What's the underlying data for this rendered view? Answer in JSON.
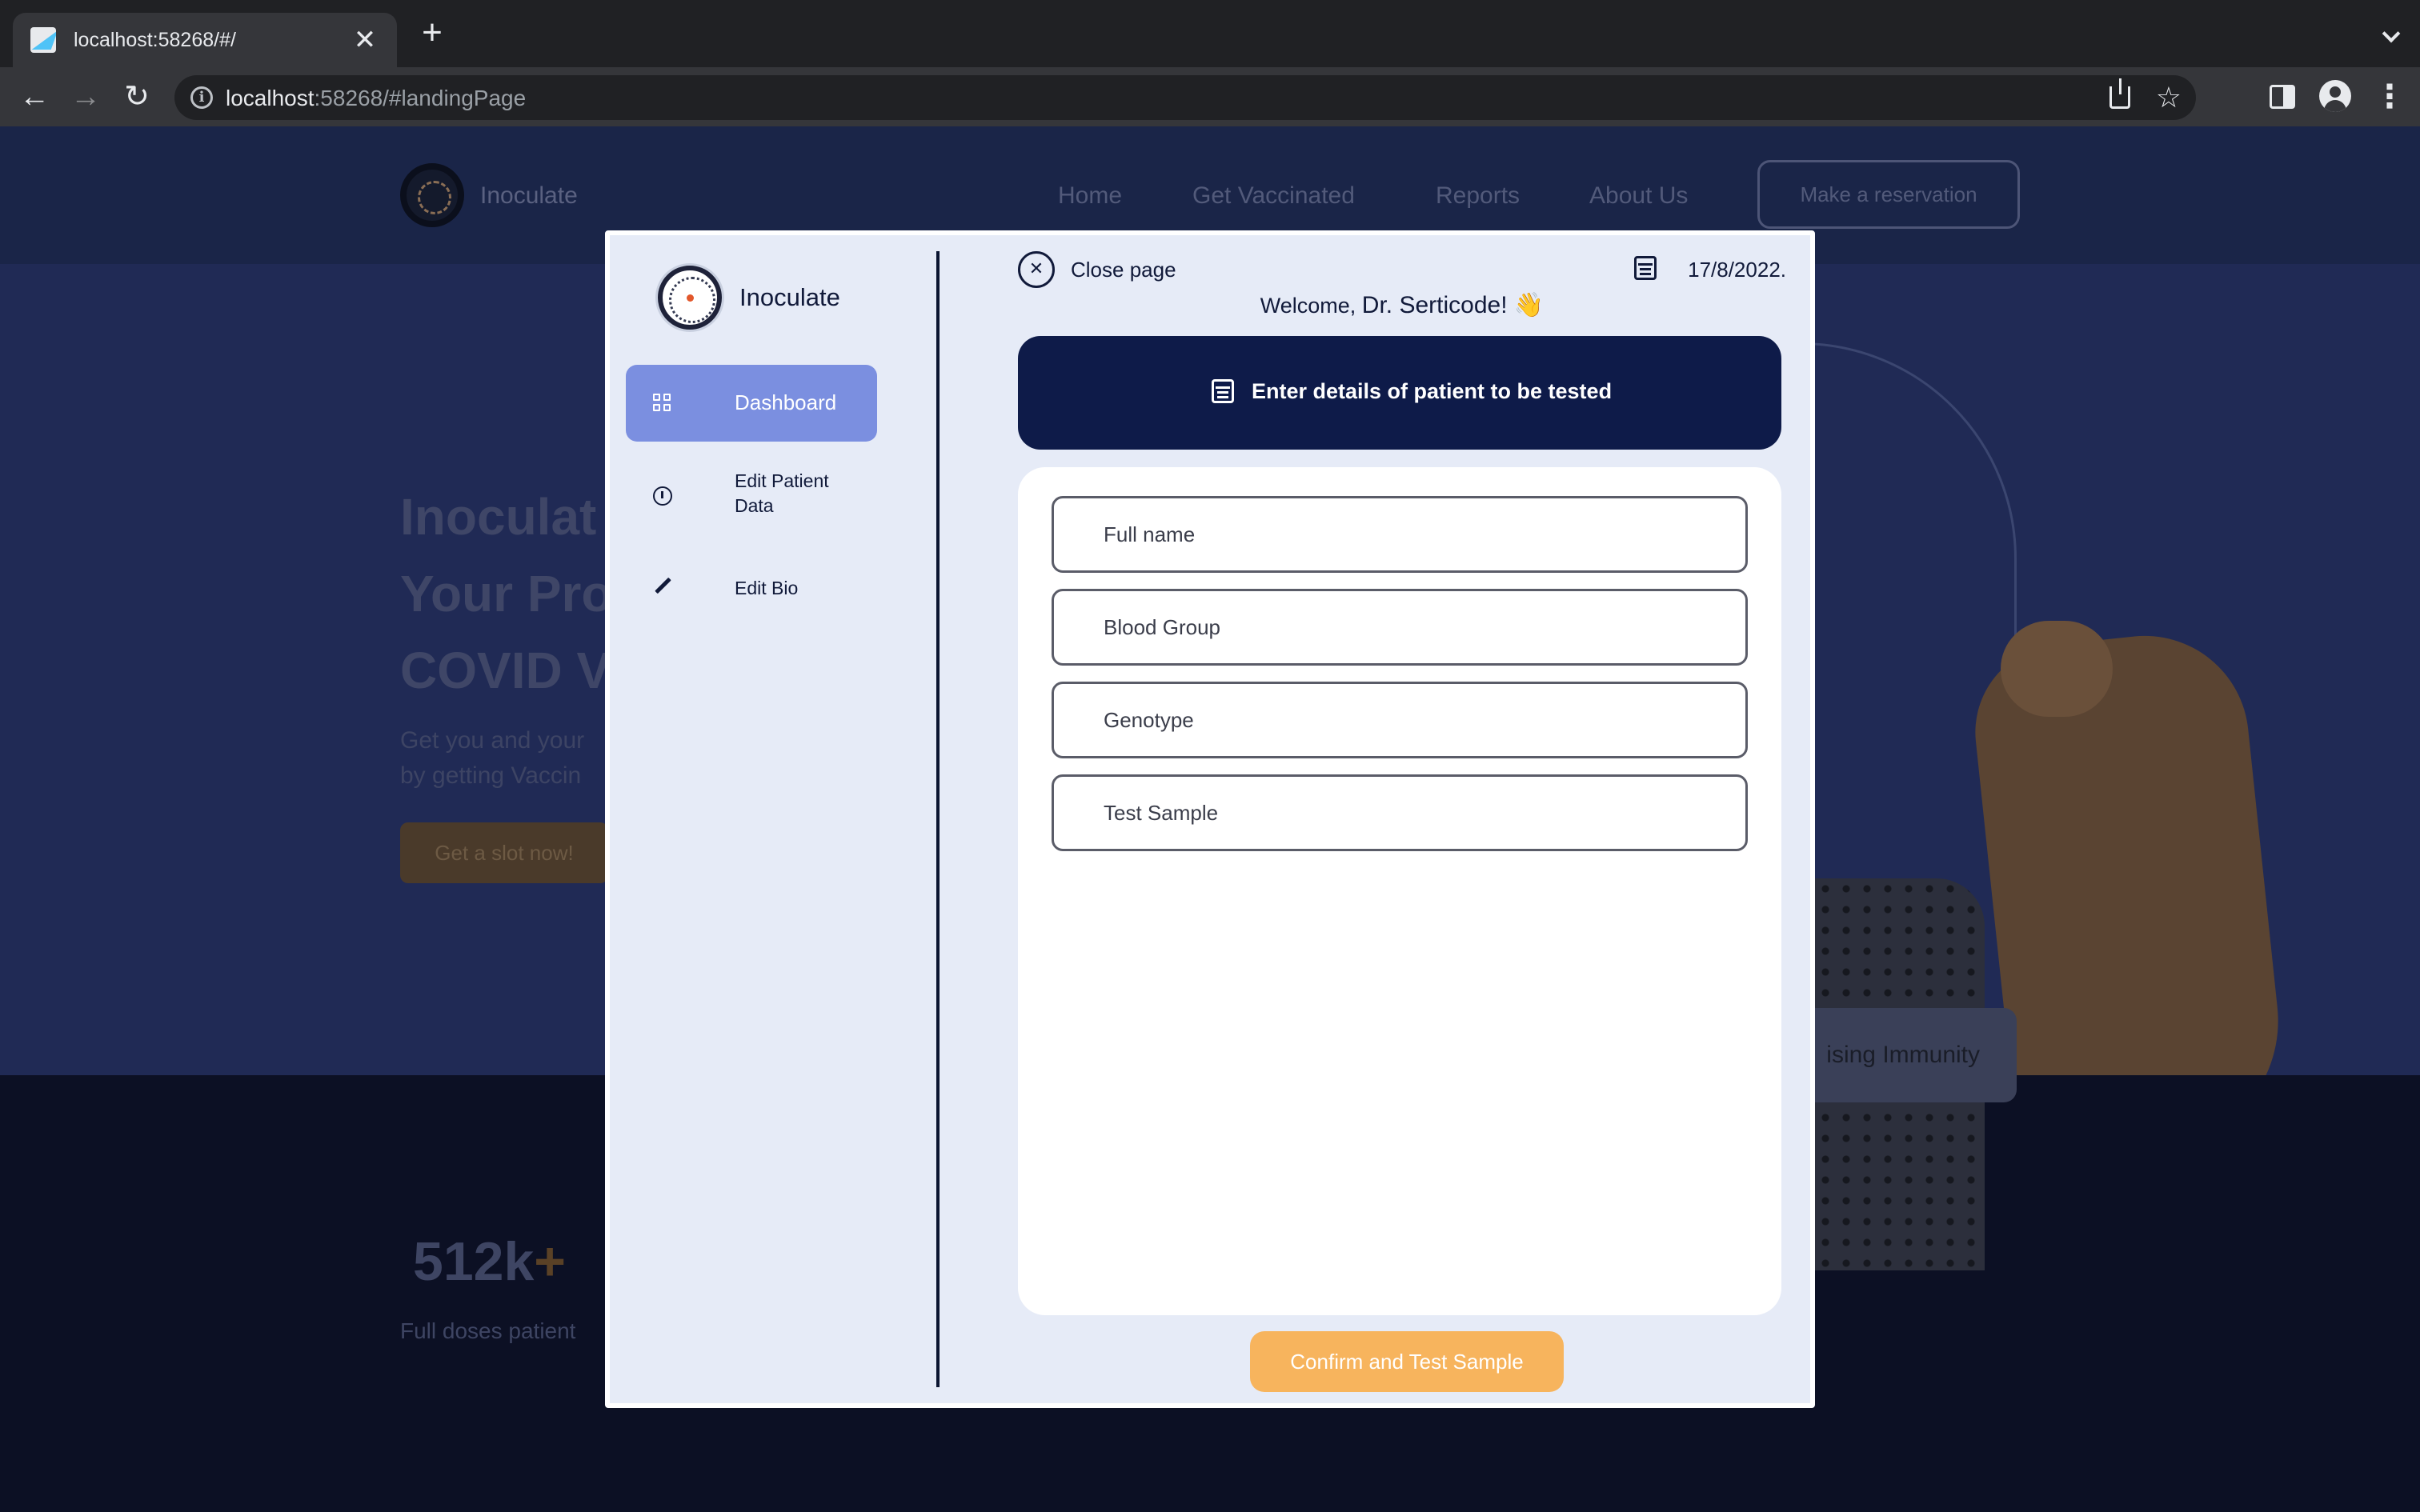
{
  "browser": {
    "tab_title": "localhost:58268/#/",
    "tab_close": "✕",
    "new_tab": "+",
    "url_host": "localhost",
    "url_rest": ":58268/#landingPage"
  },
  "landing": {
    "brand": "Inoculate",
    "nav_links": [
      "Home",
      "Get Vaccinated",
      "Reports",
      "About Us"
    ],
    "reserve_button": "Make a reservation",
    "hero_title_lines": [
      "Inoculat",
      "Your Pro",
      "COVID V"
    ],
    "hero_sub_lines": [
      "Get you and your",
      "by getting Vaccin"
    ],
    "hero_cta": "Get a slot now!",
    "immunity_card": "ising Immunity",
    "stat_value": "512k",
    "stat_plus": "+",
    "stat_label": "Full doses patient"
  },
  "modal": {
    "brand": "Inoculate",
    "sidebar": {
      "items": [
        {
          "label": "Dashboard",
          "icon": "dashboard-grid-icon",
          "active": true
        },
        {
          "label": "Edit Patient Data",
          "icon": "info-circle-icon",
          "active": false
        },
        {
          "label": "Edit Bio",
          "icon": "pencil-icon",
          "active": false
        }
      ]
    },
    "close_icon": "✕",
    "close_label": "Close page",
    "date": "17/8/2022.",
    "welcome_prefix": "Welcome, ",
    "welcome_name": "Dr. Serticode! 👋",
    "header_text": "Enter details of patient to be tested",
    "form": {
      "fields": [
        {
          "placeholder": "Full name",
          "value": ""
        },
        {
          "placeholder": "Blood Group",
          "value": ""
        },
        {
          "placeholder": "Genotype",
          "value": ""
        },
        {
          "placeholder": "Test Sample",
          "value": ""
        }
      ]
    },
    "confirm_button": "Confirm and Test Sample"
  },
  "colors": {
    "accent_button": "#f7b45d",
    "active_nav": "#7b8fe0",
    "header_card": "#0e1b49",
    "modal_bg": "#e6ebf7"
  }
}
